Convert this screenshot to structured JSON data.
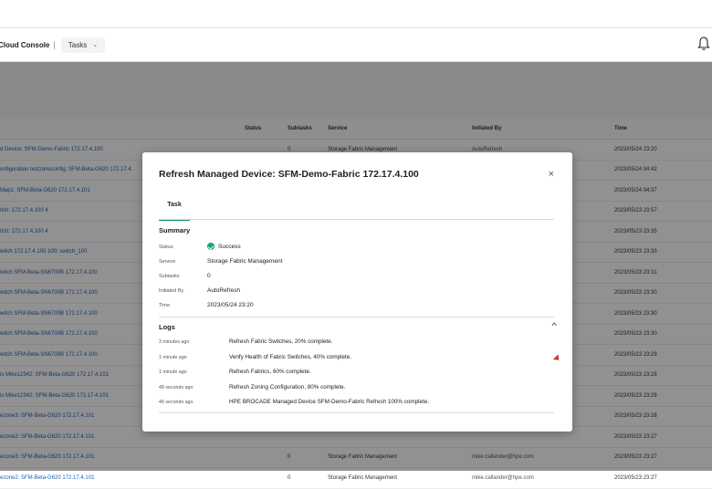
{
  "header": {
    "brand": "Cloud Console",
    "separator": "|",
    "tasks_label": "Tasks",
    "tasks_chevron": "⌄"
  },
  "table": {
    "columns": [
      "",
      "Status",
      "Subtasks",
      "Service",
      "Initiated By",
      "Time"
    ],
    "rows": [
      {
        "device": "d Device: SFM-Demo-Fabric 172.17.4.100",
        "subtasks": "0",
        "service": "Storage Fabric Management",
        "initiated_by": "AutoRefresh",
        "time": "2023/05/24 23:20"
      },
      {
        "device": "onfiguration testzoneconfig: SFM-Beta-G620 172.17.4.",
        "subtasks": "",
        "service": "",
        "initiated_by": "",
        "time": "2023/05/24 04:42"
      },
      {
        "device": "Map1: SFM-Beta-G620 172.17.4.101",
        "subtasks": "",
        "service": "",
        "initiated_by": "",
        "time": "2023/05/24 04:37"
      },
      {
        "device": "itch: 172.17.4.100 4",
        "subtasks": "",
        "service": "",
        "initiated_by": "",
        "time": "2023/05/23 23:57"
      },
      {
        "device": "itch: 172.17.4.100 4",
        "subtasks": "",
        "service": "",
        "initiated_by": "",
        "time": "2023/05/23 23:35"
      },
      {
        "device": "witch 172.17.4.100 100: switch_100",
        "subtasks": "",
        "service": "",
        "initiated_by": "",
        "time": "2023/05/23 23:33"
      },
      {
        "device": "witch SFM-Beta-SN6700B 172.17.4.100",
        "subtasks": "",
        "service": "",
        "initiated_by": "",
        "time": "2023/05/23 23:31"
      },
      {
        "device": "witch SFM-Beta-SN6700B 172.17.4.100",
        "subtasks": "",
        "service": "",
        "initiated_by": "",
        "time": "2023/05/23 23:30"
      },
      {
        "device": "witch SFM-Beta-SN6700B 172.17.4.100",
        "subtasks": "",
        "service": "",
        "initiated_by": "",
        "time": "2023/05/23 23:30"
      },
      {
        "device": "witch SFM-Beta-SN6700B 172.17.4.100",
        "subtasks": "",
        "service": "",
        "initiated_by": "",
        "time": "2023/05/23 23:30"
      },
      {
        "device": "witch SFM-Beta-SN6700B 172.17.4.100",
        "subtasks": "",
        "service": "",
        "initiated_by": "",
        "time": "2023/05/23 23:29"
      },
      {
        "device": "is Mike12342: SFM-Beta-G620 172.17.4.101",
        "subtasks": "",
        "service": "",
        "initiated_by": "",
        "time": "2023/05/23 23:28"
      },
      {
        "device": "is Mike12342: SFM-Beta-G620 172.17.4.101",
        "subtasks": "",
        "service": "",
        "initiated_by": "",
        "time": "2023/05/23 23:28"
      },
      {
        "device": "ezone3: SFM-Beta-G620 172.17.4.101",
        "subtasks": "",
        "service": "",
        "initiated_by": "",
        "time": "2023/05/23 23:28"
      },
      {
        "device": "ezone2: SFM-Beta-G620 172.17.4.101",
        "subtasks": "",
        "service": "",
        "initiated_by": "",
        "time": "2023/05/23 23:27"
      },
      {
        "device": "ezone3: SFM-Beta-G620 172.17.4.101",
        "subtasks": "0",
        "service": "Storage Fabric Management",
        "initiated_by": "mike.callander@hpe.com",
        "time": "2023/05/23 23:27"
      },
      {
        "device": "ezone2: SFM-Beta-G620 172.17.4.101",
        "subtasks": "0",
        "service": "Storage Fabric Management",
        "initiated_by": "mike.callander@hpe.com",
        "time": "2023/05/23 23:27"
      }
    ]
  },
  "modal": {
    "title": "Refresh Managed Device: SFM-Demo-Fabric 172.17.4.100",
    "close": "×",
    "tab": "Task",
    "summary_heading": "Summary",
    "summary": {
      "status_label": "Status",
      "status_value": "Success",
      "service_label": "Service",
      "service_value": "Storage Fabric Management",
      "subtasks_label": "Subtasks",
      "subtasks_value": "0",
      "initiated_label": "Initiated By",
      "initiated_value": "AutoRefresh",
      "time_label": "Time",
      "time_value": "2023/05/24 23:20"
    },
    "logs_heading": "Logs",
    "logs_chevron": "^",
    "logs": [
      {
        "time": "3 minutes ago",
        "message": "Refresh Fabric Switches, 20% complete."
      },
      {
        "time": "1 minute ago",
        "message": "Verify Health of Fabric Switches, 40% complete."
      },
      {
        "time": "1 minute ago",
        "message": "Refresh Fabrics, 60% complete."
      },
      {
        "time": "48 seconds ago",
        "message": "Refresh Zoning Configuration, 80% complete."
      },
      {
        "time": "46 seconds ago",
        "message": "HPE BROCADE Managed Device SFM-Demo-Fabric Refresh 100% complete."
      }
    ]
  }
}
